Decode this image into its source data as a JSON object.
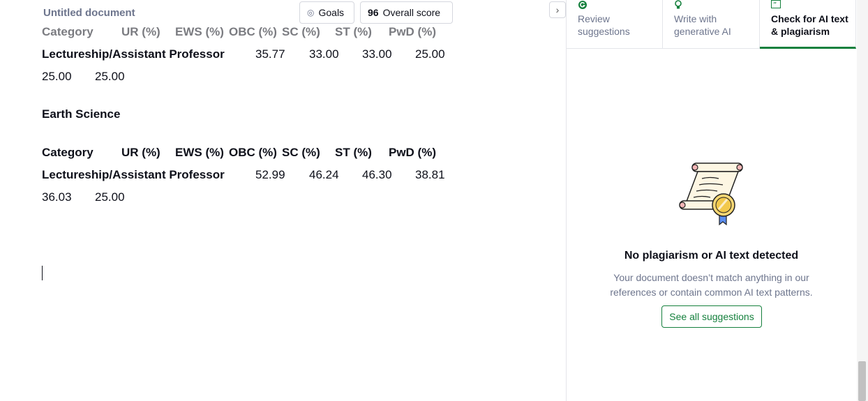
{
  "header": {
    "title": "Untitled document",
    "goals_label": "Goals",
    "score_value": "96",
    "score_label": "Overall score"
  },
  "document": {
    "section1": {
      "header_cells": [
        "Category",
        "UR (%)",
        "EWS (%)",
        "OBC (%)",
        "SC (%)",
        "ST (%)",
        "PwD (%)"
      ],
      "row_label": "Lectureship/Assistant Professor",
      "row_values": [
        "35.77",
        "33.00",
        "33.00",
        "25.00"
      ],
      "row_values_wrap": [
        "25.00",
        "25.00"
      ]
    },
    "section2": {
      "heading": "Earth Science",
      "header_cells": [
        "Category",
        "UR (%)",
        "EWS (%)",
        "OBC (%)",
        "SC (%)",
        "ST (%)",
        "PwD (%)"
      ],
      "row_label": "Lectureship/Assistant Professor",
      "row_values": [
        "52.99",
        "46.24",
        "46.30",
        "38.81"
      ],
      "row_values_wrap": [
        "36.03",
        "25.00"
      ]
    }
  },
  "panel": {
    "tabs": [
      {
        "label": "Review suggestions",
        "icon": "grammarly-g-icon"
      },
      {
        "label": "Write with generative AI",
        "icon": "lightbulb-icon"
      },
      {
        "label": "Check for AI text & plagiarism",
        "icon": "quote-icon"
      }
    ],
    "active_tab": 2,
    "result_title": "No plagiarism or AI text detected",
    "result_description": "Your document doesn’t match anything in our references or contain common AI text patterns.",
    "see_all_label": "See all suggestions"
  },
  "colors": {
    "accent": "#15803d",
    "muted_text": "#6d758d",
    "text": "#0e101a"
  }
}
